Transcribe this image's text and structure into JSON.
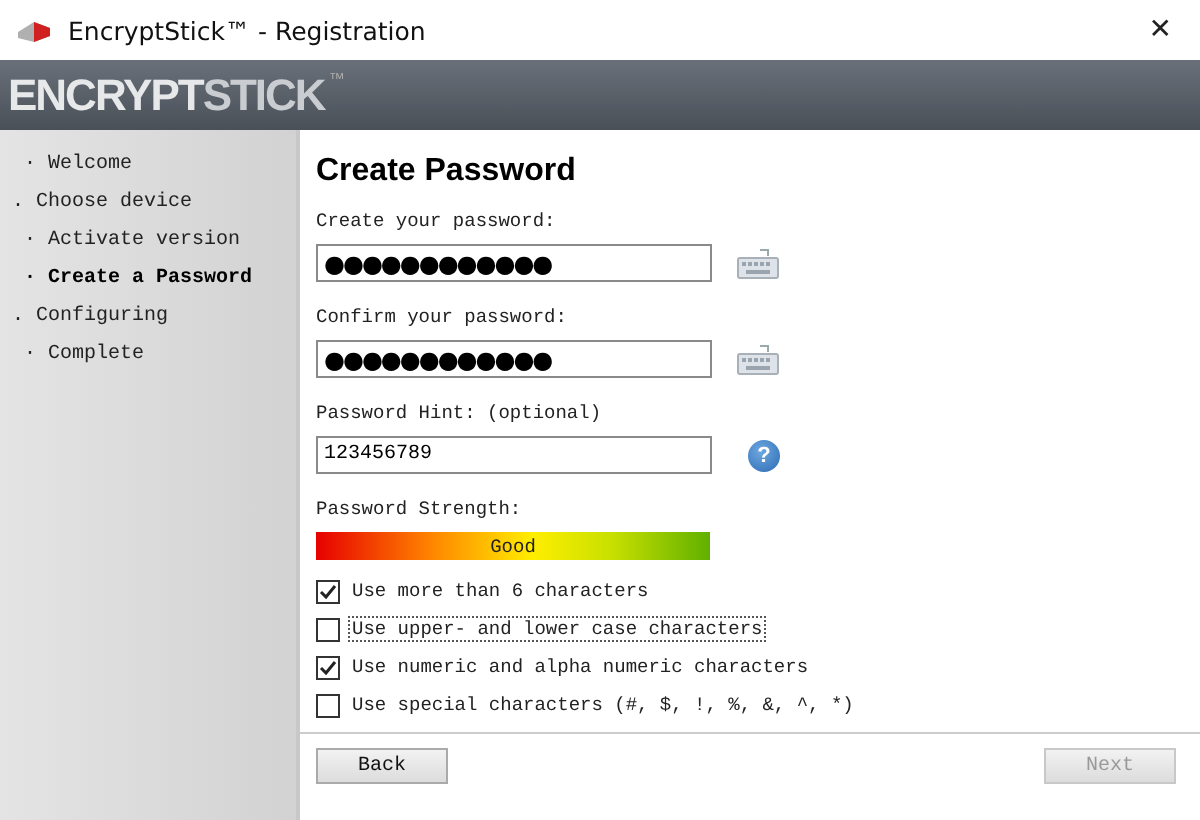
{
  "window": {
    "title": "EncryptStick™ - Registration",
    "close": "✕"
  },
  "banner": {
    "logo_a": "ENCRYPT",
    "logo_b": "STICK",
    "tm": "™"
  },
  "sidebar": {
    "items": [
      {
        "marker": "·",
        "label": "Welcome",
        "selected": false
      },
      {
        "marker": ".",
        "label": "Choose device",
        "selected": false
      },
      {
        "marker": "·",
        "label": "Activate version",
        "selected": false
      },
      {
        "marker": "·",
        "label": "Create a Password",
        "selected": true
      },
      {
        "marker": ".",
        "label": "Configuring",
        "selected": false
      },
      {
        "marker": "·",
        "label": "Complete",
        "selected": false
      }
    ]
  },
  "heading": "Create Password",
  "fields": [
    {
      "label": "Create your password:",
      "value": "●●●●●●●●●●●●",
      "kind": "keyboard"
    },
    {
      "label": "Confirm your password:",
      "value": "●●●●●●●●●●●●",
      "kind": "keyboard"
    },
    {
      "label": "Password Hint: (optional)",
      "value": "123456789",
      "kind": "help",
      "icon": "?"
    }
  ],
  "strength": {
    "label": "Password Strength:",
    "reading": "Good"
  },
  "rules": [
    {
      "label": "Use more than 6 characters",
      "checked": true,
      "focused": false
    },
    {
      "label": "Use upper- and lower case characters",
      "checked": false,
      "focused": true
    },
    {
      "label": "Use numeric and alpha numeric characters",
      "checked": true,
      "focused": false
    },
    {
      "label": "Use special characters (#, $, !, %, &, ^, *)",
      "checked": false,
      "focused": false
    }
  ],
  "buttons": [
    {
      "label": "Back",
      "disabled": false
    },
    {
      "label": "Next",
      "disabled": true
    }
  ]
}
